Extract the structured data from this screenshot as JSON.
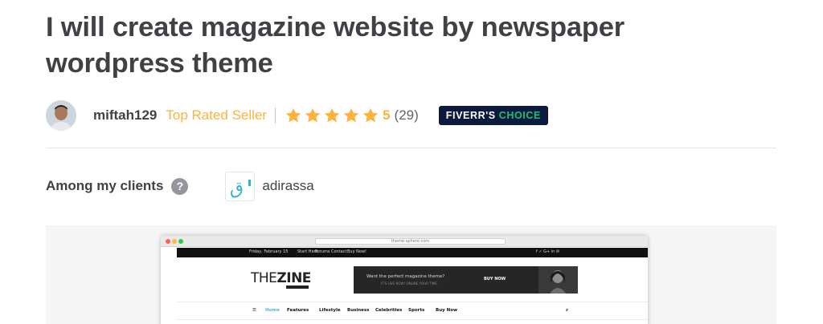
{
  "gig": {
    "title": "I will create magazine website by newspaper wordpress theme"
  },
  "seller": {
    "username": "miftah129",
    "level": "Top Rated Seller",
    "rating": "5",
    "reviews_count": "(29)",
    "stars": 5,
    "badge_part1": "FIVERR'S",
    "badge_part2": "CHOICE"
  },
  "clients": {
    "label": "Among my clients",
    "help_icon": "?",
    "items": [
      {
        "name": "adirassa",
        "logo_glyph": "ق"
      }
    ]
  },
  "preview": {
    "url": "theme-sphere.com",
    "topbar": {
      "date": "Friday, February 15",
      "links": [
        "Start Here",
        "Forums",
        "Contact",
        "Buy Now!"
      ],
      "social": "f  ✓  G+  in  ✉"
    },
    "logo_prefix": "THE",
    "logo_emph": "ZINE",
    "ad": {
      "headline": "Want the perfect magazine theme?",
      "subline": "IT'S LIVE NOW! ONLINE YOUR TIME.",
      "button": "BUY NOW"
    },
    "menu": [
      "☰",
      "Home",
      "Features",
      "Lifestyle",
      "Business",
      "Celebrities",
      "Sports",
      "Buy Now"
    ],
    "search_icon": "⌕"
  },
  "colors": {
    "accent_yellow": "#ffb33e",
    "badge_bg": "#0b1a3d",
    "badge_green": "#1dbf73",
    "text_dark": "#404145"
  }
}
